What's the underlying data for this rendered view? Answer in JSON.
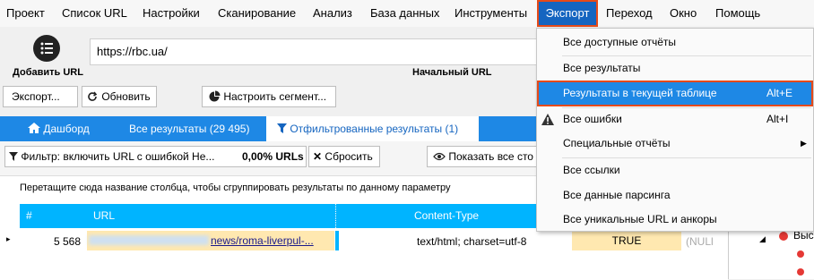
{
  "menubar": {
    "items": [
      {
        "label": "Проект"
      },
      {
        "label": "Список URL"
      },
      {
        "label": "Настройки"
      },
      {
        "label": "Сканирование"
      },
      {
        "label": "Анализ"
      },
      {
        "label": "База данных"
      },
      {
        "label": "Инструменты"
      },
      {
        "label": "Экспорт"
      },
      {
        "label": "Переход"
      },
      {
        "label": "Окно"
      },
      {
        "label": "Помощь"
      }
    ]
  },
  "toolbar": {
    "add_url_label": "Добавить URL",
    "url_value": "https://rbc.ua/",
    "start_url_label": "Начальный URL",
    "export_button": "Экспорт...",
    "refresh_button": "Обновить",
    "segment_button": "Настроить сегмент..."
  },
  "tabs": [
    {
      "label": "Дашборд"
    },
    {
      "label": "Все результаты (29 495)"
    },
    {
      "label": "Отфильтрованные результаты (1)"
    }
  ],
  "filterbar": {
    "filter_label": "Фильтр: включить URL с ошибкой Не...",
    "percent": "0,00% URLs",
    "reset_button": "Сбросить",
    "show_all_button": "Показать все сто"
  },
  "grid": {
    "group_hint": "Перетащите сюда название столбца, чтобы сгруппировать результаты по данному параметру",
    "columns": [
      "#",
      "URL",
      "Content-Type"
    ],
    "row": {
      "num": "5 568",
      "url_visible": "news/roma-liverpul-...",
      "content_type": "text/html; charset=utf-8",
      "flag": "TRUE",
      "null_text": "(NULl"
    }
  },
  "export_menu": {
    "items": [
      {
        "label": "Все доступные отчёты",
        "shortcut": ""
      },
      {
        "label": "Все результаты",
        "shortcut": ""
      },
      {
        "label": "Результаты в текущей таблице",
        "shortcut": "Alt+E"
      },
      {
        "label": "Все ошибки",
        "shortcut": "Alt+I"
      },
      {
        "label": "Специальные отчёты",
        "shortcut": ""
      },
      {
        "label": "Все ссылки",
        "shortcut": ""
      },
      {
        "label": "Все данные парсинга",
        "shortcut": ""
      },
      {
        "label": "Все уникальные URL и анкоры",
        "shortcut": ""
      }
    ]
  },
  "right_panel": {
    "tree_text": "Выс"
  },
  "colors": {
    "accent": "#1e88e5",
    "grid_header": "#00b4ff",
    "highlight_border": "#e64a19",
    "true_cell": "#ffe8b0"
  }
}
